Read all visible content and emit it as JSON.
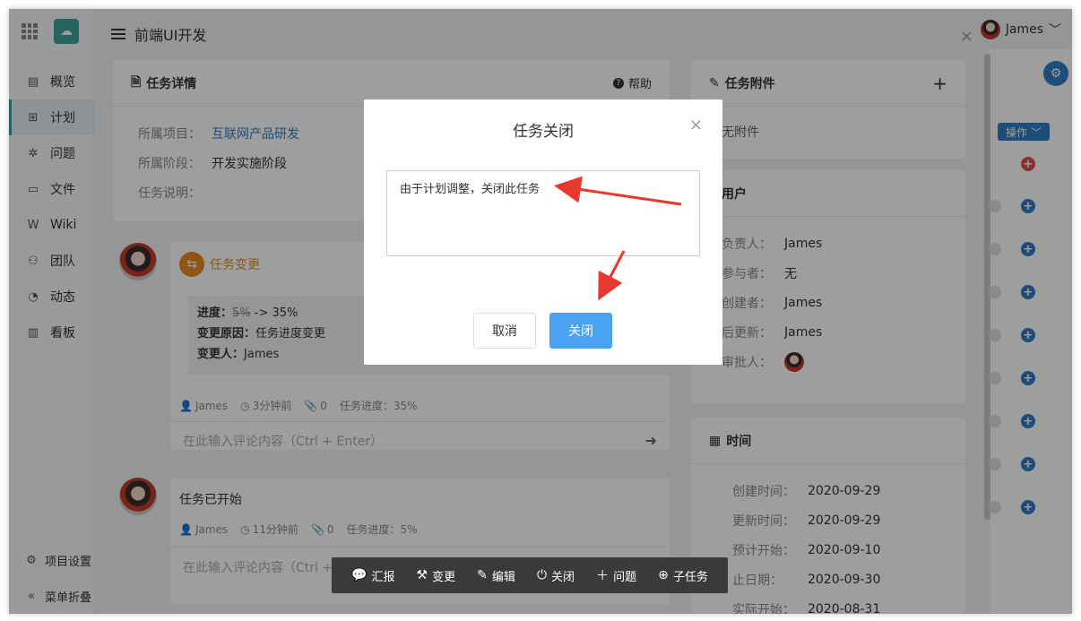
{
  "header": {
    "title": "前端UI开发",
    "user_name": "James"
  },
  "nav": {
    "items": [
      {
        "label": "概览",
        "icon": "overview-icon"
      },
      {
        "label": "计划",
        "icon": "plan-icon"
      },
      {
        "label": "问题",
        "icon": "bug-icon"
      },
      {
        "label": "文件",
        "icon": "folder-icon"
      },
      {
        "label": "Wiki",
        "icon": "wiki-icon"
      },
      {
        "label": "团队",
        "icon": "team-icon"
      },
      {
        "label": "动态",
        "icon": "activity-icon"
      },
      {
        "label": "看板",
        "icon": "board-icon"
      }
    ],
    "bottom": {
      "settings": "项目设置",
      "collapse": "菜单折叠"
    }
  },
  "task_detail": {
    "title": "任务详情",
    "help": "帮助",
    "project_label": "所属项目：",
    "project_value": "互联网产品研发",
    "stage_label": "所属阶段：",
    "stage_value": "开发实施阶段",
    "desc_label": "任务说明："
  },
  "activity1": {
    "title": "任务变更",
    "progress_label": "进度：",
    "progress_old": "5%",
    "progress_arrow": "-> 35%",
    "reason_label": "变更原因：",
    "reason_value": "任务进度变更",
    "changer_label": "变更人：",
    "changer_value": "James",
    "meta_user": "James",
    "meta_time": "3分钟前",
    "meta_attach": "0",
    "meta_progress": "任务进度：35%",
    "comment_placeholder": "在此输入评论内容（Ctrl + Enter）"
  },
  "activity2": {
    "title": "任务已开始",
    "meta_user": "James",
    "meta_time": "11分钟前",
    "meta_attach": "0",
    "meta_progress": "任务进度：5%",
    "comment_placeholder": "在此输入评论内容（Ctrl + Enter）"
  },
  "attachments": {
    "title": "任务附件",
    "add": "+",
    "empty": "无附件"
  },
  "users": {
    "title": "用户",
    "owner_label": "负责人：",
    "owner_value": "James",
    "participant_label": "参与者：",
    "participant_value": "无",
    "creator_label": "创建者：",
    "creator_value": "James",
    "updater_label": "后更新：",
    "updater_value": "James",
    "approver_label": "审批人："
  },
  "time": {
    "title": "时间",
    "created_label": "创建时间：",
    "created_value": "2020-09-29",
    "updated_label": "更新时间：",
    "updated_value": "2020-09-29",
    "plan_start_label": "预计开始：",
    "plan_start_value": "2020-09-10",
    "deadline_label": "止日期：",
    "deadline_value": "2020-09-30",
    "actual_start_label": "实际开始：",
    "actual_start_value": "2020-08-31"
  },
  "far_right": {
    "ops_label": "操作"
  },
  "modal": {
    "title": "任务关闭",
    "textarea_value": "由于计划调整，关闭此任务",
    "cancel_label": "取消",
    "confirm_label": "关闭"
  },
  "toolbar": {
    "items": [
      {
        "label": "汇报",
        "icon": "chat-icon"
      },
      {
        "label": "变更",
        "icon": "hammer-icon"
      },
      {
        "label": "编辑",
        "icon": "edit-icon"
      },
      {
        "label": "关闭",
        "icon": "power-icon"
      },
      {
        "label": "问题",
        "icon": "plus-icon"
      },
      {
        "label": "子任务",
        "icon": "plus-circle-icon"
      }
    ]
  },
  "colors": {
    "accent": "#2f7cc4",
    "brand": "#3aa39a",
    "primary_button": "#4aa3f0",
    "annotation_arrow": "#e8382f"
  }
}
